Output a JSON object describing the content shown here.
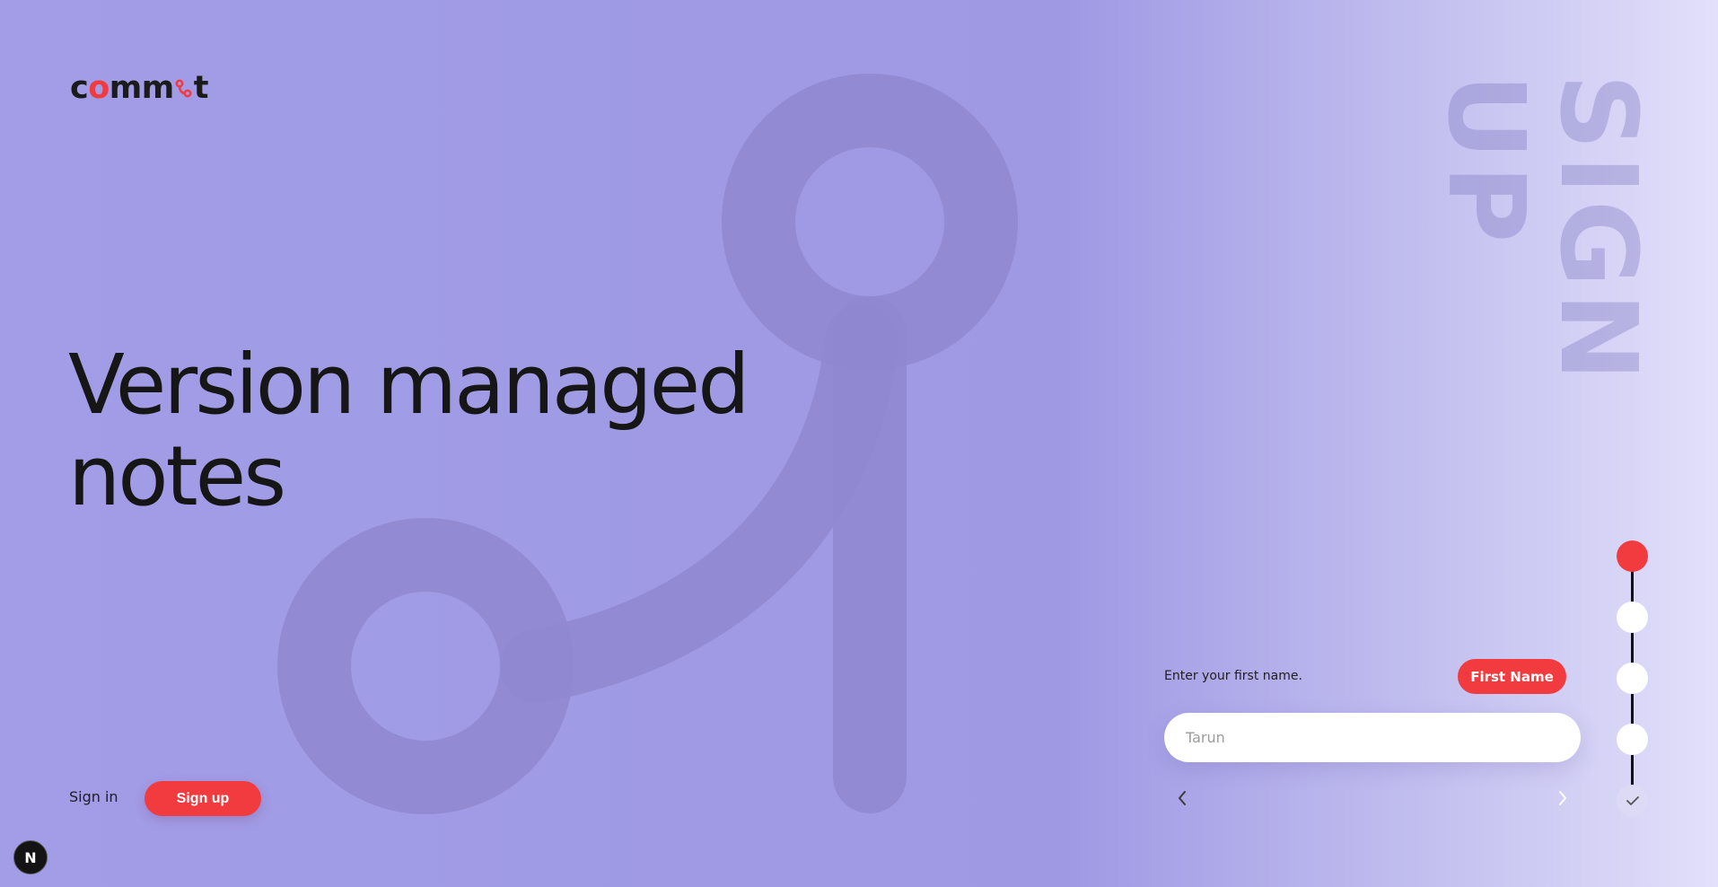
{
  "brand": {
    "logo_prefix": "c",
    "logo_o": "o",
    "logo_mid": "mm",
    "logo_suffix": "t",
    "accent": "#f23b3f"
  },
  "hero": {
    "line1": "Version managed",
    "line2": "notes"
  },
  "side_title": {
    "word1": "SIGN",
    "word2": "UP"
  },
  "auth": {
    "signin_label": "Sign in",
    "signup_label": "Sign up"
  },
  "form": {
    "prompt": "Enter your first name.",
    "field_tag": "First Name",
    "input_value": "",
    "input_placeholder": "Tarun",
    "prev_icon": "chevron-left-icon",
    "next_icon": "chevron-right-icon"
  },
  "stepper": {
    "total_steps": 5,
    "current_step": 1,
    "final_icon": "check-icon"
  },
  "dev_badge": {
    "label": "N"
  }
}
